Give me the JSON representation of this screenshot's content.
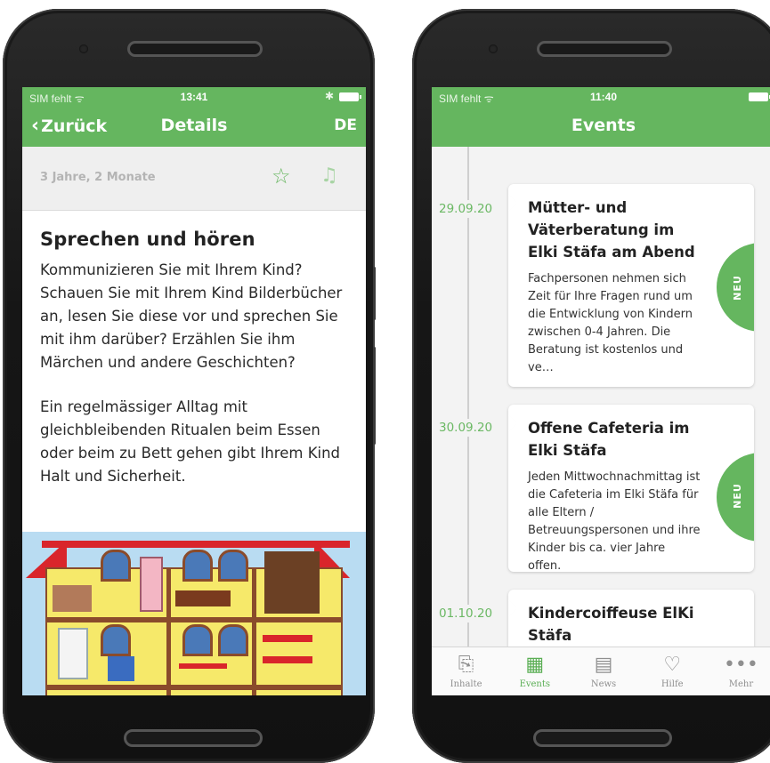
{
  "left_phone": {
    "status": {
      "carrier": "SIM fehlt",
      "wifi_icon": "wifi-icon",
      "time": "13:41",
      "bluetooth_icon": "bluetooth-icon"
    },
    "nav": {
      "back_label": "Zurück",
      "title": "Details",
      "language": "DE"
    },
    "meta": {
      "age": "3 Jahre, 2 Monate",
      "favorite_icon": "star-outline-icon",
      "audio_icon": "music-note-icon"
    },
    "article": {
      "heading": "Sprechen und hören",
      "paragraphs": [
        "Kommunizieren Sie mit Ihrem Kind? Schauen Sie mit Ihrem Kind Bilderbücher an, lesen Sie diese vor und sprechen Sie mit ihm darüber? Erzählen Sie ihm Märchen und andere Geschichten?",
        "Ein regelmässiger Alltag mit gleichbleibenden Ritualen beim Essen oder beim zu Bett gehen gibt Ihrem Kind Halt und Sicherheit."
      ]
    }
  },
  "right_phone": {
    "status": {
      "carrier": "SIM fehlt",
      "wifi_icon": "wifi-icon",
      "time": "11:40"
    },
    "nav": {
      "title": "Events"
    },
    "events": [
      {
        "date": "29.09.20",
        "title": "Mütter- und Väterberatung im Elki Stäfa am Abend",
        "description": "Fachpersonen nehmen sich Zeit für Ihre Fragen rund um die Entwicklung von Kindern zwischen 0-4 Jahren. Die Beratung ist kostenlos und ve…",
        "badge": "NEU"
      },
      {
        "date": "30.09.20",
        "title": "Offene Cafeteria im Elki Stäfa",
        "description": "Jeden Mittwochnachmittag ist die Cafeteria im Elki Stäfa für alle Eltern / Betreuungspersonen und ihre Kinder bis ca. vier Jahre offen.",
        "badge": "NEU"
      },
      {
        "date": "01.10.20",
        "title": "Kindercoiffeuse ElKi Stäfa",
        "description": "",
        "badge": ""
      }
    ],
    "tabs": [
      {
        "label": "Inhalte",
        "icon": "documents-icon",
        "active": false
      },
      {
        "label": "Events",
        "icon": "calendar-icon",
        "active": true
      },
      {
        "label": "News",
        "icon": "newspaper-icon",
        "active": false
      },
      {
        "label": "Hilfe",
        "icon": "handshake-icon",
        "active": false
      },
      {
        "label": "Mehr",
        "icon": "more-dots-icon",
        "active": false
      }
    ]
  },
  "colors": {
    "brand_green": "#65b65f",
    "accent_green": "#6bb864",
    "roof_red": "#d9252b",
    "house_yellow": "#f6e96a"
  }
}
